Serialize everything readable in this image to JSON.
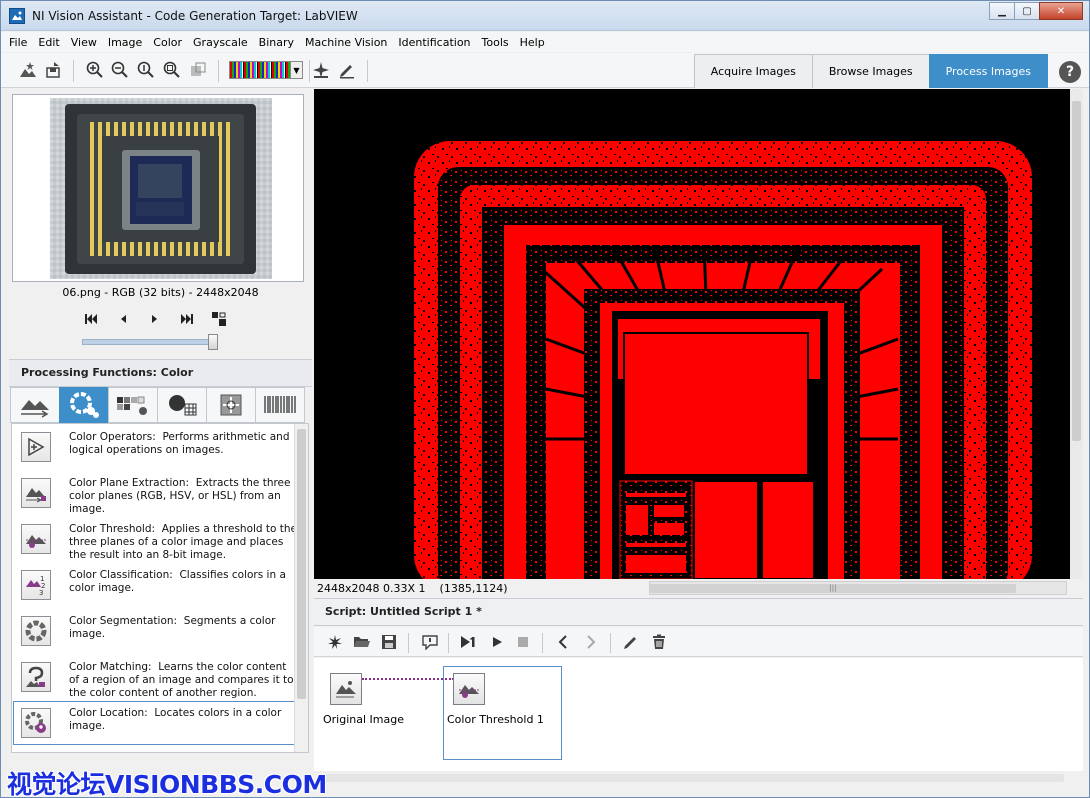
{
  "window": {
    "title": "NI Vision Assistant - Code Generation Target: LabVIEW",
    "minimize": "▁",
    "maximize": "▢",
    "close": "✕"
  },
  "menu": [
    "File",
    "Edit",
    "View",
    "Image",
    "Color",
    "Grayscale",
    "Binary",
    "Machine Vision",
    "Identification",
    "Tools",
    "Help"
  ],
  "tabs": {
    "acquire": "Acquire Images",
    "browse": "Browse Images",
    "process": "Process Images",
    "active": "process"
  },
  "help": "?",
  "browser": {
    "image_info": "06.png - RGB (32 bits) - 2448x2048"
  },
  "processing": {
    "title": "Processing Functions: Color",
    "functions": [
      {
        "name": "Color Operators:",
        "desc": "Performs arithmetic and logical operations on images.",
        "icon": "plus-arrow-icon"
      },
      {
        "name": "Color Plane Extraction:",
        "desc": "Extracts the three color planes (RGB, HSV, or HSL) from an image.",
        "icon": "color-plane-icon"
      },
      {
        "name": "Color Threshold:",
        "desc": "Applies a threshold to the three planes of a color image and places the result into an 8-bit image.",
        "icon": "color-threshold-icon"
      },
      {
        "name": "Color Classification:",
        "desc": "Classifies colors in a color image.",
        "icon": "color-classification-icon"
      },
      {
        "name": "Color Segmentation:",
        "desc": "Segments a color image.",
        "icon": "color-wheel-icon"
      },
      {
        "name": "Color Matching:",
        "desc": "Learns the color content of a region of an image and compares it to the color content of another region.",
        "icon": "color-matching-icon"
      },
      {
        "name": "Color Location:",
        "desc": "Locates colors in a color image.",
        "icon": "color-location-icon"
      }
    ],
    "selected_index": 6
  },
  "viewer": {
    "status_size": "2448x2048",
    "status_zoom": "0.33X 1",
    "status_coords": "(1385,1124)",
    "scroll_grip": "|||",
    "threshold_color": "#ff0000"
  },
  "script": {
    "title": "Script: Untitled Script 1 *",
    "steps": [
      {
        "label": "Original Image"
      },
      {
        "label": "Color Threshold 1"
      }
    ]
  },
  "watermark": "视觉论坛VISIONBBS.COM",
  "colors": {
    "accent": "#3d8ec9",
    "threshold": "#ff0000",
    "watermark": "#1c2fe0"
  }
}
